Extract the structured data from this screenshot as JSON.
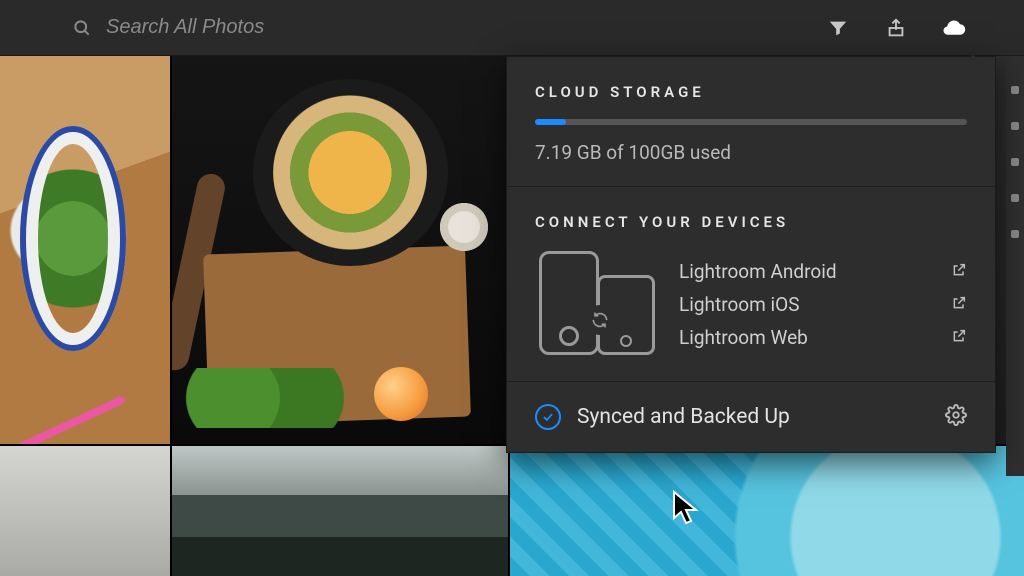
{
  "search": {
    "placeholder": "Search All Photos"
  },
  "cloud_panel": {
    "storage_title": "CLOUD STORAGE",
    "used_gb": "7.19",
    "total_gb": "100",
    "usage_text": "7.19 GB of 100GB used",
    "usage_percent": 7.19,
    "devices_title": "CONNECT YOUR DEVICES",
    "devices": [
      {
        "label": "Lightroom Android"
      },
      {
        "label": "Lightroom iOS"
      },
      {
        "label": "Lightroom Web"
      }
    ],
    "status_text": "Synced and Backed Up"
  },
  "icons": {
    "search": "search-icon",
    "filter": "filter-icon",
    "share": "share-icon",
    "cloud": "cloud-icon",
    "external": "external-link-icon",
    "check": "check-icon",
    "gear": "gear-icon",
    "sync": "sync-icon"
  },
  "colors": {
    "accent": "#1a8cff",
    "panel": "#2d2d2d"
  }
}
